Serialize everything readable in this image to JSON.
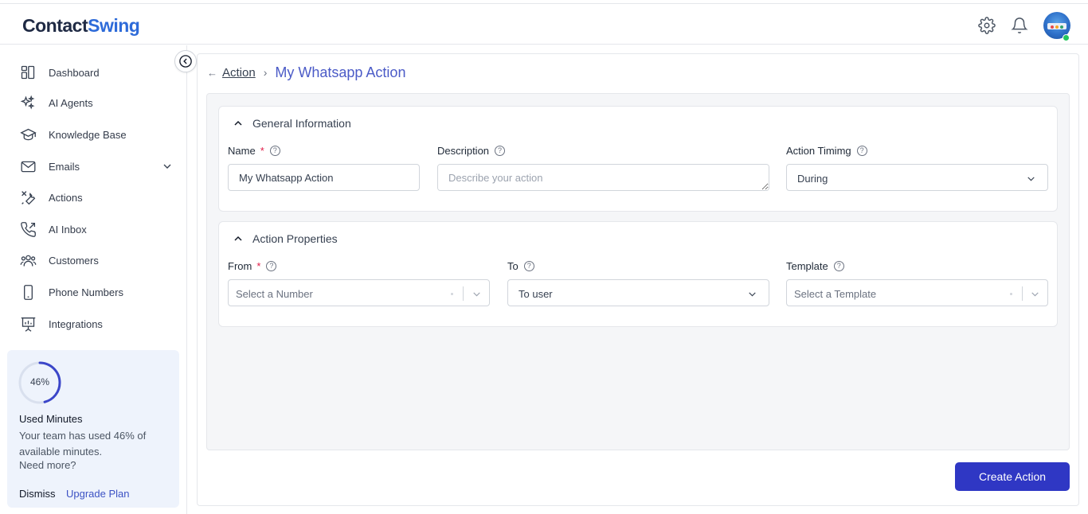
{
  "header": {
    "logo_part1": "Contact",
    "logo_part2": "Swing"
  },
  "sidebar": {
    "items": [
      {
        "label": "Dashboard",
        "icon": "dashboard-icon"
      },
      {
        "label": "AI Agents",
        "icon": "sparkles-icon"
      },
      {
        "label": "Knowledge Base",
        "icon": "graduation-cap-icon"
      },
      {
        "label": "Emails",
        "icon": "mail-icon"
      },
      {
        "label": "Actions",
        "icon": "tools-icon"
      },
      {
        "label": "AI Inbox",
        "icon": "phone-incoming-icon"
      },
      {
        "label": "Customers",
        "icon": "users-icon"
      },
      {
        "label": "Phone Numbers",
        "icon": "smartphone-icon"
      },
      {
        "label": "Integrations",
        "icon": "presentation-chart-icon"
      }
    ],
    "usage": {
      "percent_label": "46%",
      "percent": 0.46,
      "title": "Used Minutes",
      "text": "Your team has used 46% of available minutes.",
      "more": "Need more?",
      "dismiss": "Dismiss",
      "upgrade": "Upgrade Plan"
    }
  },
  "breadcrumb": {
    "back_arrow": "←",
    "parent": "Action",
    "separator": "›",
    "current": "My Whatsapp Action"
  },
  "general": {
    "title": "General Information",
    "name_label": "Name",
    "name_required": "*",
    "name_value": "My Whatsapp Action",
    "description_label": "Description",
    "description_placeholder": "Describe your action",
    "timing_label": "Action Timimg",
    "timing_value": "During"
  },
  "properties": {
    "title": "Action Properties",
    "from_label": "From",
    "from_required": "*",
    "from_placeholder": "Select a Number",
    "to_label": "To",
    "to_value": "To user",
    "template_label": "Template",
    "template_placeholder": "Select a Template"
  },
  "help_glyph": "?",
  "actions": {
    "create": "Create Action"
  },
  "colors": {
    "primary": "#2f37c4",
    "accent_text": "#4b5bc7",
    "required": "#e11d48",
    "usage_card_bg": "#eef3fc",
    "online": "#22c55e"
  }
}
